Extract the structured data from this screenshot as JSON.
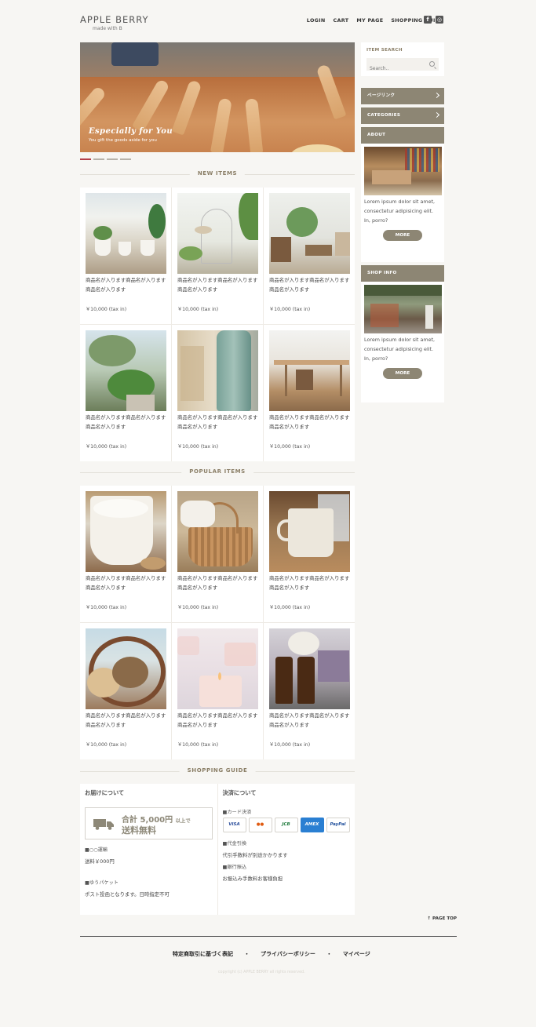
{
  "header": {
    "logo": "APPLE BERRY",
    "tagline": "made with B",
    "nav": [
      "LOGIN",
      "CART",
      "MY PAGE",
      "SHOPPING GUIDE"
    ],
    "social": [
      "facebook-icon",
      "instagram-icon"
    ]
  },
  "hero": {
    "caption_title": "Especially for You",
    "caption_text": "You gift the goods aside for you",
    "slides": 4,
    "active_slide": 1
  },
  "new_items": {
    "title": "NEW ITEMS",
    "items": [
      {
        "name": "商品名が入ります商品名が入ります商品名が入ります",
        "price": "￥10,000 (tax in)"
      },
      {
        "name": "商品名が入ります商品名が入ります商品名が入ります",
        "price": "￥10,000 (tax in)"
      },
      {
        "name": "商品名が入ります商品名が入ります商品名が入ります",
        "price": "￥10,000 (tax in)"
      },
      {
        "name": "商品名が入ります商品名が入ります商品名が入ります",
        "price": "￥10,000 (tax in)"
      },
      {
        "name": "商品名が入ります商品名が入ります商品名が入ります",
        "price": "￥10,000 (tax in)"
      },
      {
        "name": "商品名が入ります商品名が入ります商品名が入ります",
        "price": "￥10,000 (tax in)"
      }
    ]
  },
  "popular_items": {
    "title": "POPULAR ITEMS",
    "items": [
      {
        "name": "商品名が入ります商品名が入ります商品名が入ります",
        "price": "￥10,000 (tax in)"
      },
      {
        "name": "商品名が入ります商品名が入ります商品名が入ります",
        "price": "￥10,000 (tax in)"
      },
      {
        "name": "商品名が入ります商品名が入ります商品名が入ります",
        "price": "￥10,000 (tax in)"
      },
      {
        "name": "商品名が入ります商品名が入ります商品名が入ります",
        "price": "￥10,000 (tax in)"
      },
      {
        "name": "商品名が入ります商品名が入ります商品名が入ります",
        "price": "￥10,000 (tax in)"
      },
      {
        "name": "商品名が入ります商品名が入ります商品名が入ります",
        "price": "￥10,000 (tax in)"
      }
    ]
  },
  "guide": {
    "title": "SHOPPING GUIDE",
    "delivery": {
      "heading": "お届けについて",
      "banner_line1": "合計 5,000円",
      "banner_line1_suffix": "以上で",
      "banner_line2": "送料無料",
      "shipping_label": "■○○運輸",
      "shipping_text": "送料￥000円",
      "packet_label": "■ゆうパケット",
      "packet_text": "ポスト投函となります。日時指定不可"
    },
    "payment": {
      "heading": "決済について",
      "card_label": "■カード決済",
      "cards": [
        "VISA",
        "MC",
        "JCB",
        "AMEX",
        "PayPal"
      ],
      "cod_label": "■代金引換",
      "cod_text": "代引手数料が別途かかります",
      "bank_label": "■銀行振込",
      "bank_text": "お振込み手数料お客様負担"
    }
  },
  "sidebar": {
    "search_label": "ITEM SEARCH",
    "search_placeholder": "Search..",
    "menu": [
      {
        "label": "ページリンク",
        "chevron": true
      },
      {
        "label": "CATEGORIES",
        "chevron": true
      }
    ],
    "about": {
      "heading": "ABOUT",
      "text": "Lorem ipsum dolor sit amet, consectetur adipisicing elit. In, porro?",
      "button": "MORE"
    },
    "shop_info": {
      "heading": "SHOP INFO",
      "text": "Lorem ipsum dolor sit amet, consectetur adipisicing elit. In, porro?",
      "button": "MORE"
    }
  },
  "footer": {
    "page_top": "↑ PAGE TOP",
    "links": [
      "特定商取引に基づく表記",
      "・",
      "プライバシーポリシー",
      "・",
      "マイページ"
    ],
    "copyright": "copyright (c) APPLE BERRY all rights reserved."
  }
}
